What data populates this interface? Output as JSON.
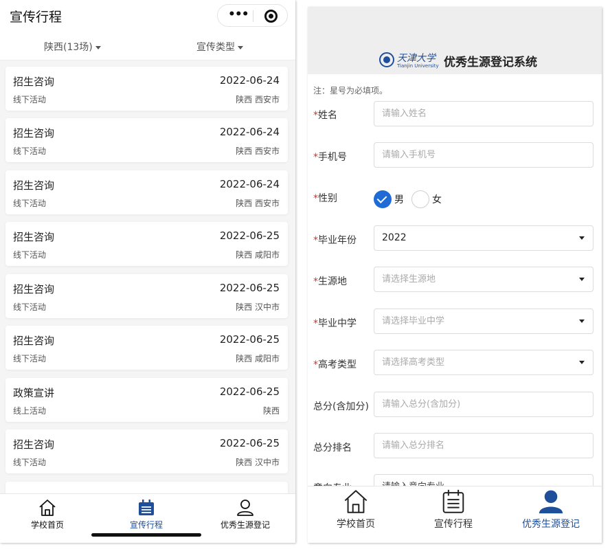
{
  "left": {
    "header_title": "宣传行程",
    "filters": {
      "region": "陕西(13场)",
      "type": "宣传类型"
    },
    "events": [
      {
        "title": "招生咨询",
        "date": "2022-06-24",
        "mode": "线下活动",
        "location": "陕西 西安市"
      },
      {
        "title": "招生咨询",
        "date": "2022-06-24",
        "mode": "线下活动",
        "location": "陕西 西安市"
      },
      {
        "title": "招生咨询",
        "date": "2022-06-24",
        "mode": "线下活动",
        "location": "陕西 西安市"
      },
      {
        "title": "招生咨询",
        "date": "2022-06-25",
        "mode": "线下活动",
        "location": "陕西 咸阳市"
      },
      {
        "title": "招生咨询",
        "date": "2022-06-25",
        "mode": "线下活动",
        "location": "陕西 汉中市"
      },
      {
        "title": "招生咨询",
        "date": "2022-06-25",
        "mode": "线下活动",
        "location": "陕西 咸阳市"
      },
      {
        "title": "政策宣讲",
        "date": "2022-06-25",
        "mode": "线上活动",
        "location": "陕西"
      },
      {
        "title": "招生咨询",
        "date": "2022-06-25",
        "mode": "线下活动",
        "location": "陕西 汉中市"
      }
    ],
    "tabs": [
      {
        "label": "学校首页",
        "icon": "home-icon"
      },
      {
        "label": "宣传行程",
        "icon": "calendar-icon"
      },
      {
        "label": "优秀生源登记",
        "icon": "user-icon"
      }
    ],
    "active_tab": "宣传行程"
  },
  "right": {
    "logo_cn": "天津大学",
    "logo_en": "Tianjin University",
    "system_title": "优秀生源登记系统",
    "note": "注：星号为必填项。",
    "fields": {
      "name": {
        "label": "姓名",
        "required": true,
        "placeholder": "请输入姓名"
      },
      "phone": {
        "label": "手机号",
        "required": true,
        "placeholder": "请输入手机号"
      },
      "gender": {
        "label": "性别",
        "required": true,
        "options": [
          "男",
          "女"
        ],
        "selected": "男"
      },
      "grad_year": {
        "label": "毕业年份",
        "required": true,
        "value": "2022"
      },
      "origin": {
        "label": "生源地",
        "required": true,
        "placeholder": "请选择生源地"
      },
      "school": {
        "label": "毕业中学",
        "required": true,
        "placeholder": "请选择毕业中学"
      },
      "exam_type": {
        "label": "高考类型",
        "required": true,
        "placeholder": "请选择高考类型"
      },
      "total_score": {
        "label": "总分(含加分)",
        "required": false,
        "placeholder": "请输入总分(含加分)"
      },
      "rank": {
        "label": "总分排名",
        "required": false,
        "placeholder": "请输入总分排名"
      },
      "major": {
        "label": "意向专业",
        "required": false,
        "placeholder": "请输入意向专业"
      }
    },
    "required_mark": "*",
    "tabs": [
      {
        "label": "学校首页",
        "icon": "home-icon"
      },
      {
        "label": "宣传行程",
        "icon": "calendar-icon"
      },
      {
        "label": "优秀生源登记",
        "icon": "user-icon"
      }
    ],
    "active_tab": "优秀生源登记",
    "accent_color": "#1e6bd6",
    "brand_color": "#1f4e9a",
    "required_color": "#d9302c"
  }
}
